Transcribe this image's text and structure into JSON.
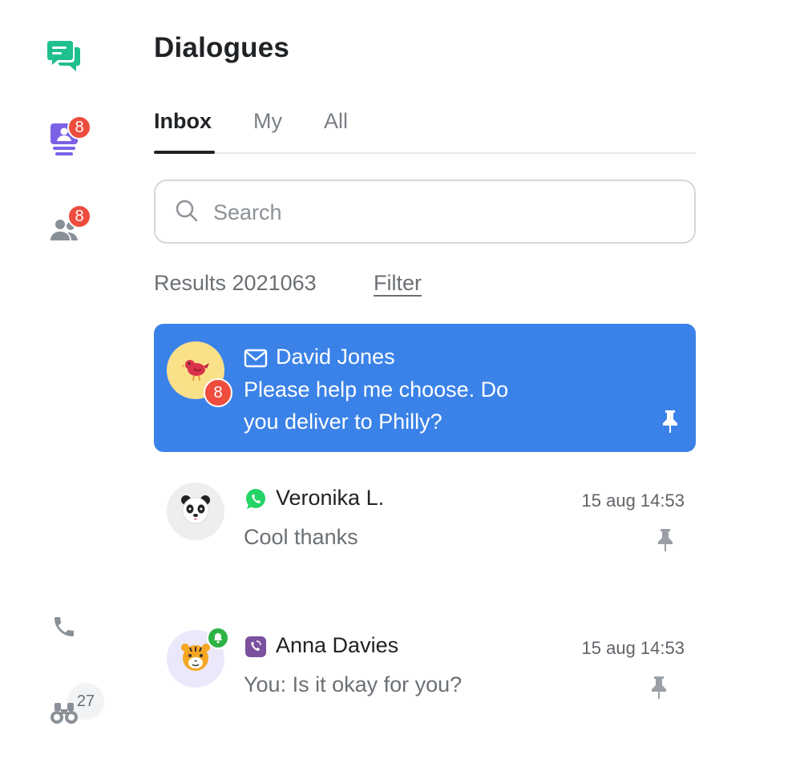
{
  "sidebar": {
    "requests_badge": "8",
    "contacts_badge": "8",
    "robots_badge": "27"
  },
  "header": {
    "title": "Dialogues"
  },
  "tabs": [
    {
      "label": "Inbox",
      "active": true
    },
    {
      "label": "My",
      "active": false
    },
    {
      "label": "All",
      "active": false
    }
  ],
  "search": {
    "placeholder": "Search",
    "value": ""
  },
  "results": {
    "label": "Results 2021063",
    "filter_label": "Filter"
  },
  "conversations": [
    {
      "name": "David Jones",
      "channel": "mail-icon",
      "avatar": "bird",
      "unread": "8",
      "message": "Please help me choose. Do you deliver to Philly?",
      "message_line1": "Please help me choose. Do",
      "message_line2": "you deliver to Philly?",
      "time": "",
      "selected": true
    },
    {
      "name": "Veronika L.",
      "channel": "whatsapp-icon",
      "avatar": "panda",
      "message": "Cool thanks",
      "time": "15 aug 14:53",
      "selected": false
    },
    {
      "name": "Anna Davies",
      "channel": "viber-icon",
      "avatar": "tiger",
      "message": "You: Is it okay for you?",
      "time": "15 aug 14:53",
      "selected": false
    }
  ],
  "colors": {
    "accent": "#3b82e8",
    "badge": "#ee4d3e",
    "chat_icon": "#1fbf8f",
    "requests_icon": "#7b61e6",
    "whatsapp": "#25d366",
    "viber": "#7b519d"
  }
}
